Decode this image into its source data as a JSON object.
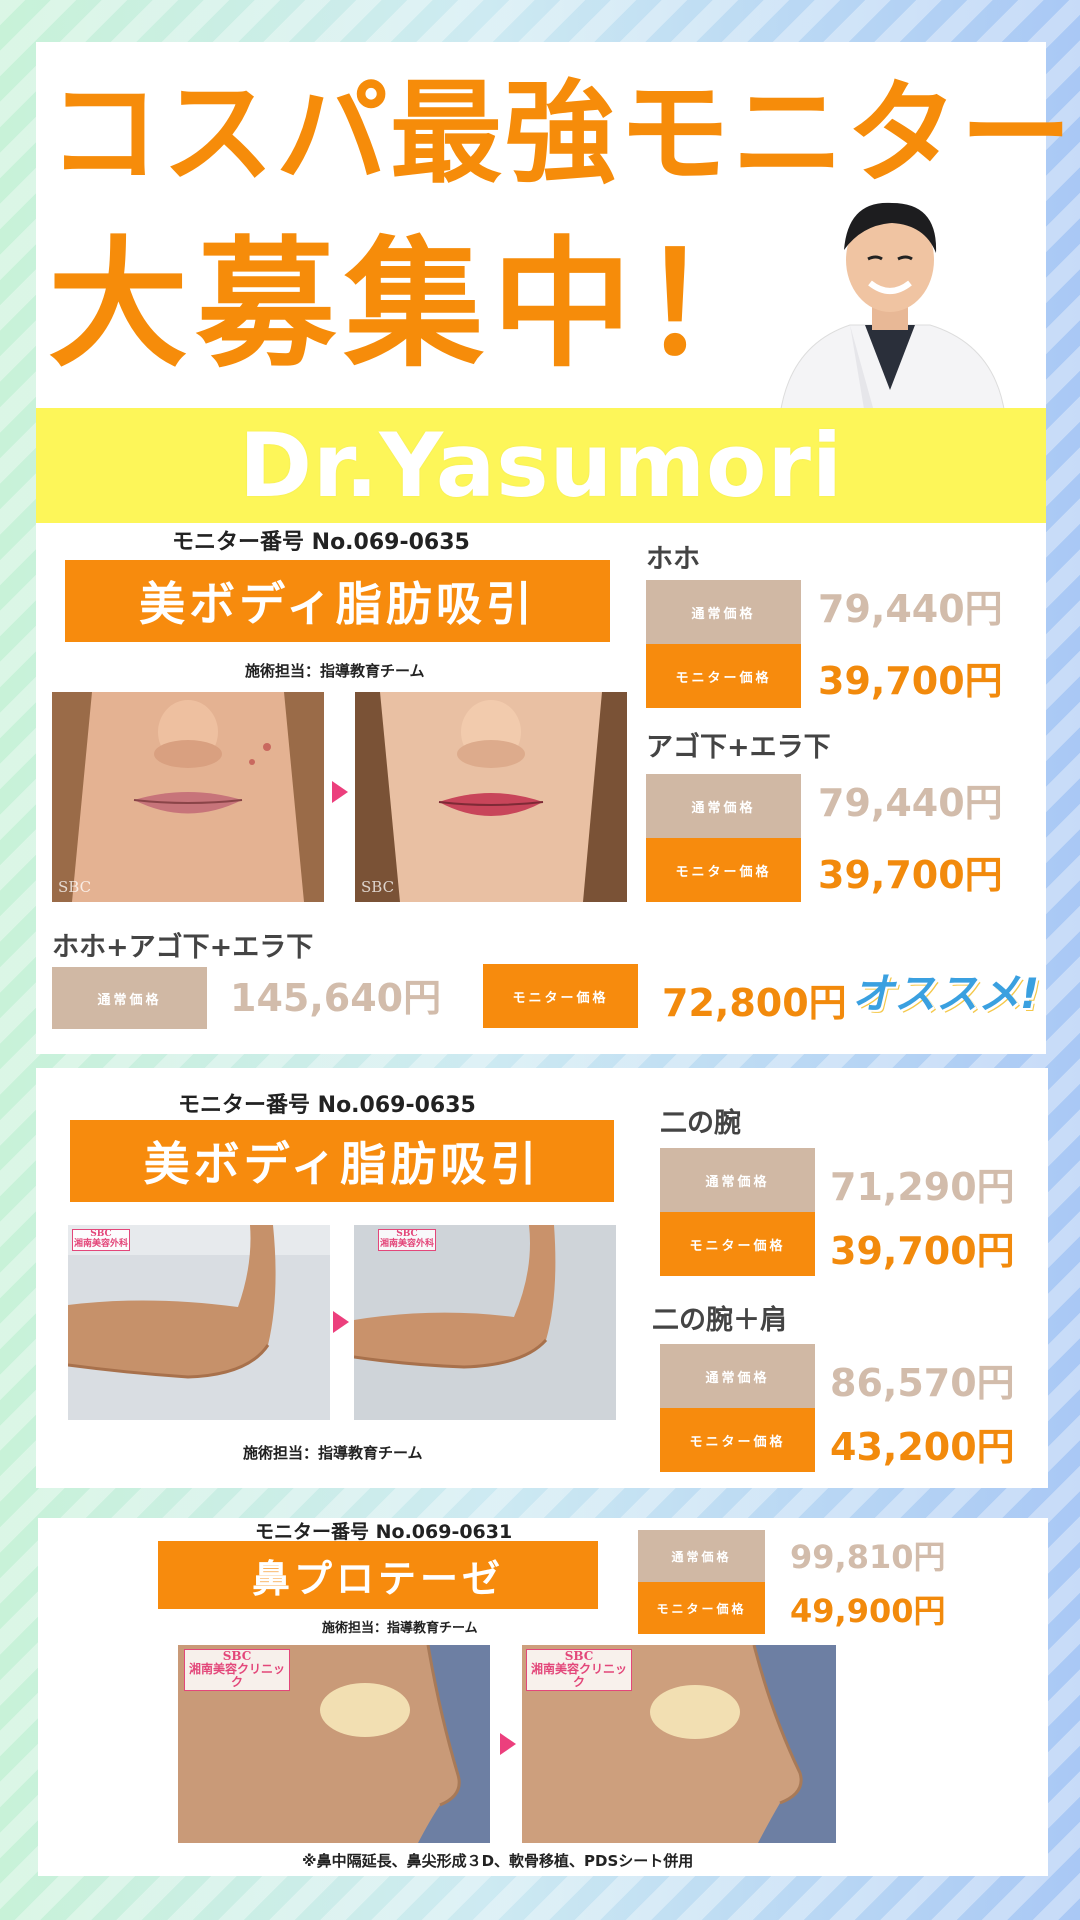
{
  "header": {
    "headline_line1": "コスパ最強モニター",
    "headline_line2": "大募集中！",
    "doctor_name": "Dr.Yasumori"
  },
  "section1": {
    "monitor_no": "モニター番号 No.069-0635",
    "title": "美ボディ脂肪吸引",
    "staff": "施術担当：指導教育チーム",
    "watermark": "SBC",
    "prices": [
      {
        "area": "ホホ",
        "normal_label": "通常価格",
        "normal_price": "79,440円",
        "monitor_label": "モニター価格",
        "monitor_price": "39,700円"
      },
      {
        "area": "アゴ下+エラ下",
        "normal_label": "通常価格",
        "normal_price": "79,440円",
        "monitor_label": "モニター価格",
        "monitor_price": "39,700円"
      }
    ],
    "combo": {
      "area": "ホホ+アゴ下+エラ下",
      "normal_label": "通常価格",
      "normal_price": "145,640円",
      "monitor_label": "モニター価格",
      "monitor_price": "72,800円",
      "badge": "オススメ!"
    }
  },
  "section2": {
    "monitor_no": "モニター番号 No.069-0635",
    "title": "美ボディ脂肪吸引",
    "staff": "施術担当：指導教育チーム",
    "clinic_badge_top": "SBC",
    "clinic_badge": "湘南美容外科",
    "prices": [
      {
        "area": "二の腕",
        "normal_label": "通常価格",
        "normal_price": "71,290円",
        "monitor_label": "モニター価格",
        "monitor_price": "39,700円"
      },
      {
        "area": "二の腕＋肩",
        "normal_label": "通常価格",
        "normal_price": "86,570円",
        "monitor_label": "モニター価格",
        "monitor_price": "43,200円"
      }
    ]
  },
  "section3": {
    "monitor_no": "モニター番号 No.069-0631",
    "title": "鼻プロテーゼ",
    "staff": "施術担当：指導教育チーム",
    "normal_label": "通常価格",
    "normal_price": "99,810円",
    "monitor_label": "モニター価格",
    "monitor_price": "49,900円",
    "clinic_badge_top": "SBC",
    "clinic_badge": "湘南美容クリニック",
    "note": "※鼻中隔延長、鼻尖形成３D、軟骨移植、PDSシート併用"
  },
  "colors": {
    "accent_orange": "#f78b0d",
    "normal_beige": "#d0b8a4",
    "banner_yellow": "#fdf659",
    "arrow_pink": "#ec3f7d"
  }
}
